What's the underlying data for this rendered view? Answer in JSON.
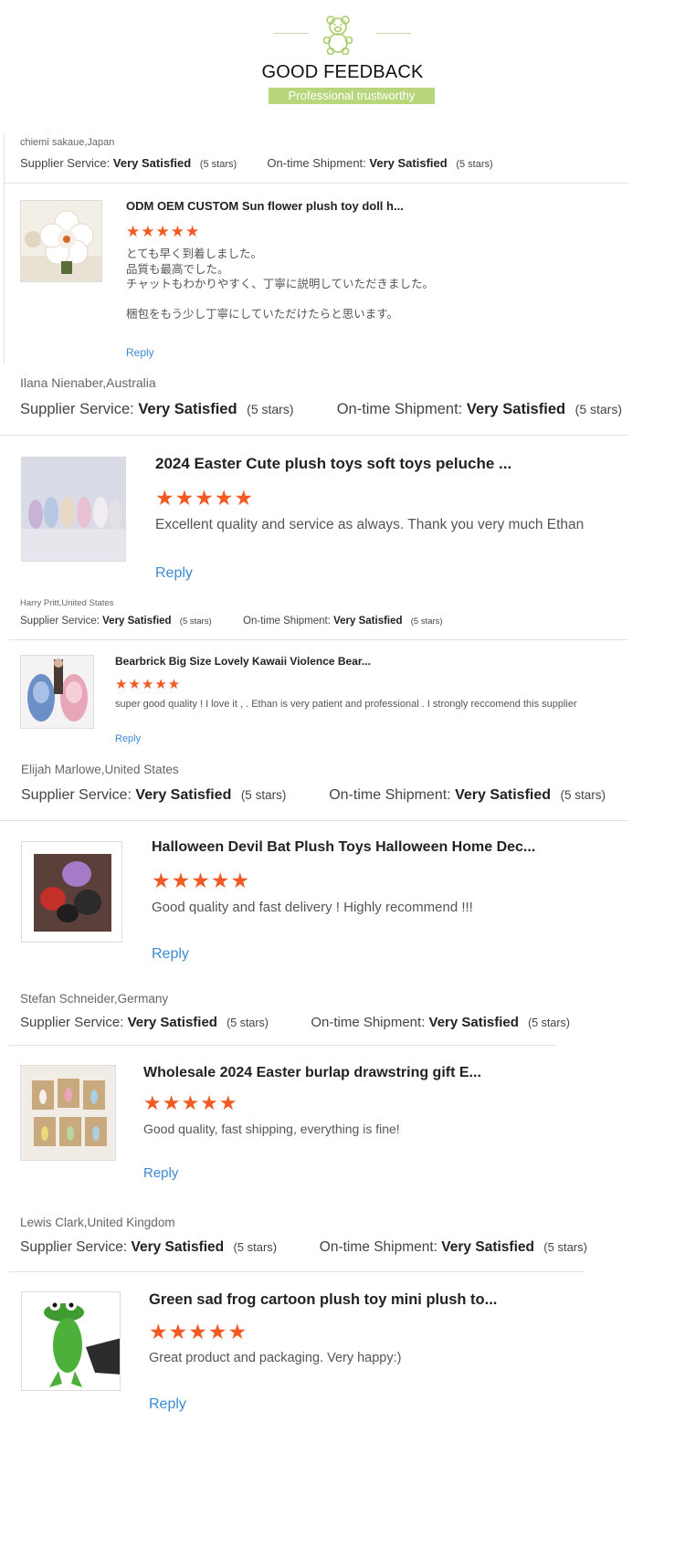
{
  "header": {
    "title": "GOOD FEEDBACK",
    "subtitle": "Professional trustworthy"
  },
  "labels": {
    "supplier_service": "Supplier Service:",
    "ontime_shipment": "On-time Shipment:",
    "reply": "Reply",
    "stars_glyphs": "★★★★★"
  },
  "reviews": [
    {
      "reviewer": "chiemi sakaue,Japan",
      "supplier_value": "Very Satisfied",
      "supplier_stars": "(5 stars)",
      "shipment_value": "Very Satisfied",
      "shipment_stars": "(5 stars)",
      "product": "ODM OEM CUSTOM Sun flower plush toy doll h...",
      "rating": 5,
      "comment": "とても早く到着しました。\n品質も最高でした。\nチャットもわかりやすく、丁寧に説明していただきました。\n\n梱包をもう少し丁寧にしていただけたらと思います。"
    },
    {
      "reviewer": "Ilana Nienaber,Australia",
      "supplier_value": "Very Satisfied",
      "supplier_stars": "(5 stars)",
      "shipment_value": "Very Satisfied",
      "shipment_stars": "(5 stars)",
      "product": "2024 Easter Cute plush toys soft toys peluche ...",
      "rating": 5,
      "comment": "Excellent quality and service as always.  Thank you very much Ethan"
    },
    {
      "reviewer": "Harry Pritt,United States",
      "supplier_value": "Very Satisfied",
      "supplier_stars": "(5 stars)",
      "shipment_value": "Very Satisfied",
      "shipment_stars": "(5 stars)",
      "product": "Bearbrick Big Size Lovely Kawaii Violence Bear...",
      "rating": 5,
      "comment": "super good quality ! I love it , . Ethan is very patient and professional . I strongly reccomend this supplier"
    },
    {
      "reviewer": "Elijah Marlowe,United States",
      "supplier_value": "Very Satisfied",
      "supplier_stars": "(5 stars)",
      "shipment_value": "Very Satisfied",
      "shipment_stars": "(5 stars)",
      "product": "Halloween Devil Bat Plush Toys Halloween Home Dec...",
      "rating": 5,
      "comment": "Good quality and fast delivery ! Highly recommend !!!"
    },
    {
      "reviewer": "Stefan Schneider,Germany",
      "supplier_value": "Very Satisfied",
      "supplier_stars": "(5 stars)",
      "shipment_value": "Very Satisfied",
      "shipment_stars": "(5 stars)",
      "product": "Wholesale 2024 Easter burlap drawstring gift E...",
      "rating": 5,
      "comment": "Good quality, fast shipping, everything is fine!"
    },
    {
      "reviewer": "Lewis Clark,United Kingdom",
      "supplier_value": "Very Satisfied",
      "supplier_stars": "(5 stars)",
      "shipment_value": "Very Satisfied",
      "shipment_stars": "(5 stars)",
      "product": "Green sad frog cartoon plush toy mini plush to...",
      "rating": 5,
      "comment": "Great product and packaging. Very happy:)"
    }
  ],
  "colors": {
    "accent_green": "#b9d67c",
    "star_orange": "#f15a22",
    "reply_blue": "#3d8ad0"
  }
}
